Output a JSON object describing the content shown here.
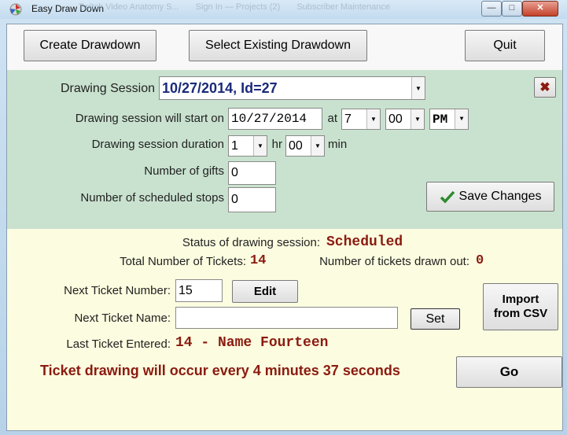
{
  "window": {
    "title": "Easy Draw Down",
    "minimize": "—",
    "maximize": "□",
    "close": "✕",
    "background_tabs": [
      "Twitch Video Anatomy S...",
      "Sign In — Projects (2)",
      "Subscriber Maintenance"
    ]
  },
  "toolbar": {
    "create": "Create Drawdown",
    "select_existing": "Select Existing Drawdown",
    "quit": "Quit"
  },
  "session": {
    "label": "Drawing Session",
    "value": "10/27/2014, Id=27",
    "close_x": "✖",
    "start_label": "Drawing session will start on",
    "start_date": "10/27/2014",
    "at": "at",
    "hour": "7",
    "minute": "00",
    "ampm": "PM",
    "duration_label": "Drawing session duration",
    "duration_hr": "1",
    "hr": "hr",
    "duration_min": "00",
    "min": "min",
    "gifts_label": "Number of gifts",
    "gifts": "0",
    "stops_label": "Number of scheduled stops",
    "stops": "0",
    "save": "Save Changes"
  },
  "status": {
    "status_label": "Status of drawing session:",
    "status_value": "Scheduled",
    "total_label": "Total Number of Tickets:",
    "total_value": "14",
    "drawn_label": "Number of tickets drawn out:",
    "drawn_value": "0",
    "next_number_label": "Next Ticket Number:",
    "next_number": "15",
    "edit": "Edit",
    "next_name_label": "Next Ticket Name:",
    "next_name": "",
    "set": "Set",
    "import_line1": "Import",
    "import_line2": "from CSV",
    "last_label": "Last Ticket Entered:",
    "last_value": "14 - Name Fourteen",
    "message": "Ticket drawing will occur every 4 minutes 37 seconds",
    "go": "Go"
  },
  "colors": {
    "green_panel": "#c9e2cf",
    "yellow_panel": "#fcfce0",
    "accent_red": "#8b1b10",
    "check_green": "#2e8b2e"
  }
}
